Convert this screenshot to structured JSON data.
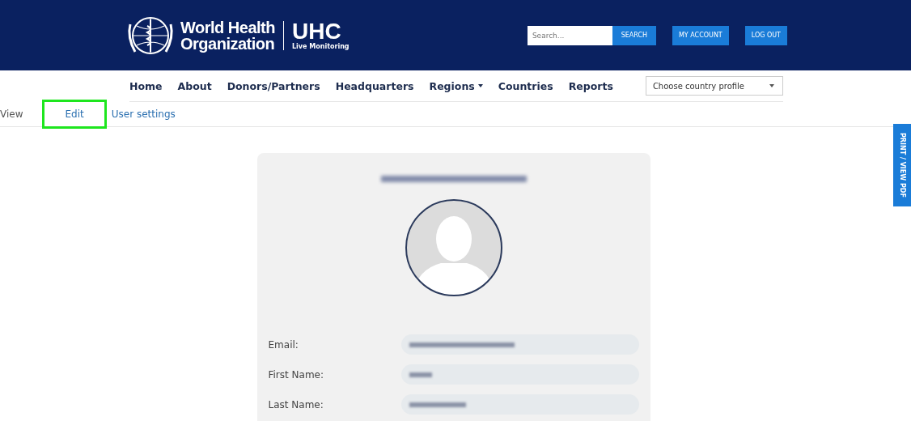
{
  "header": {
    "logo_line_1": "World Health",
    "logo_line_2": "Organization",
    "brand": "UHC",
    "brand_sub": "Live Monitoring",
    "search": {
      "placeholder": "Search..."
    },
    "buttons": [
      "SEARCH",
      "MY ACCOUNT",
      "LOG OUT"
    ]
  },
  "nav": {
    "items": [
      {
        "label": "Home",
        "has_caret": false
      },
      {
        "label": "About",
        "has_caret": false
      },
      {
        "label": "Donors/Partners",
        "has_caret": false
      },
      {
        "label": "Headquarters",
        "has_caret": false
      },
      {
        "label": "Regions",
        "has_caret": true
      },
      {
        "label": "Countries",
        "has_caret": false
      },
      {
        "label": "Reports",
        "has_caret": false
      }
    ],
    "country_select": {
      "value": "Choose country profile"
    }
  },
  "tabs": [
    {
      "label": "View",
      "highlighted": false
    },
    {
      "label": "Edit",
      "highlighted": true
    },
    {
      "label": "User settings",
      "highlighted": false
    }
  ],
  "side_button": "PRINT / VIEW PDF",
  "profile": {
    "fields": [
      {
        "label": "Email:"
      },
      {
        "label": "First Name:"
      },
      {
        "label": "Last Name:"
      }
    ]
  }
}
